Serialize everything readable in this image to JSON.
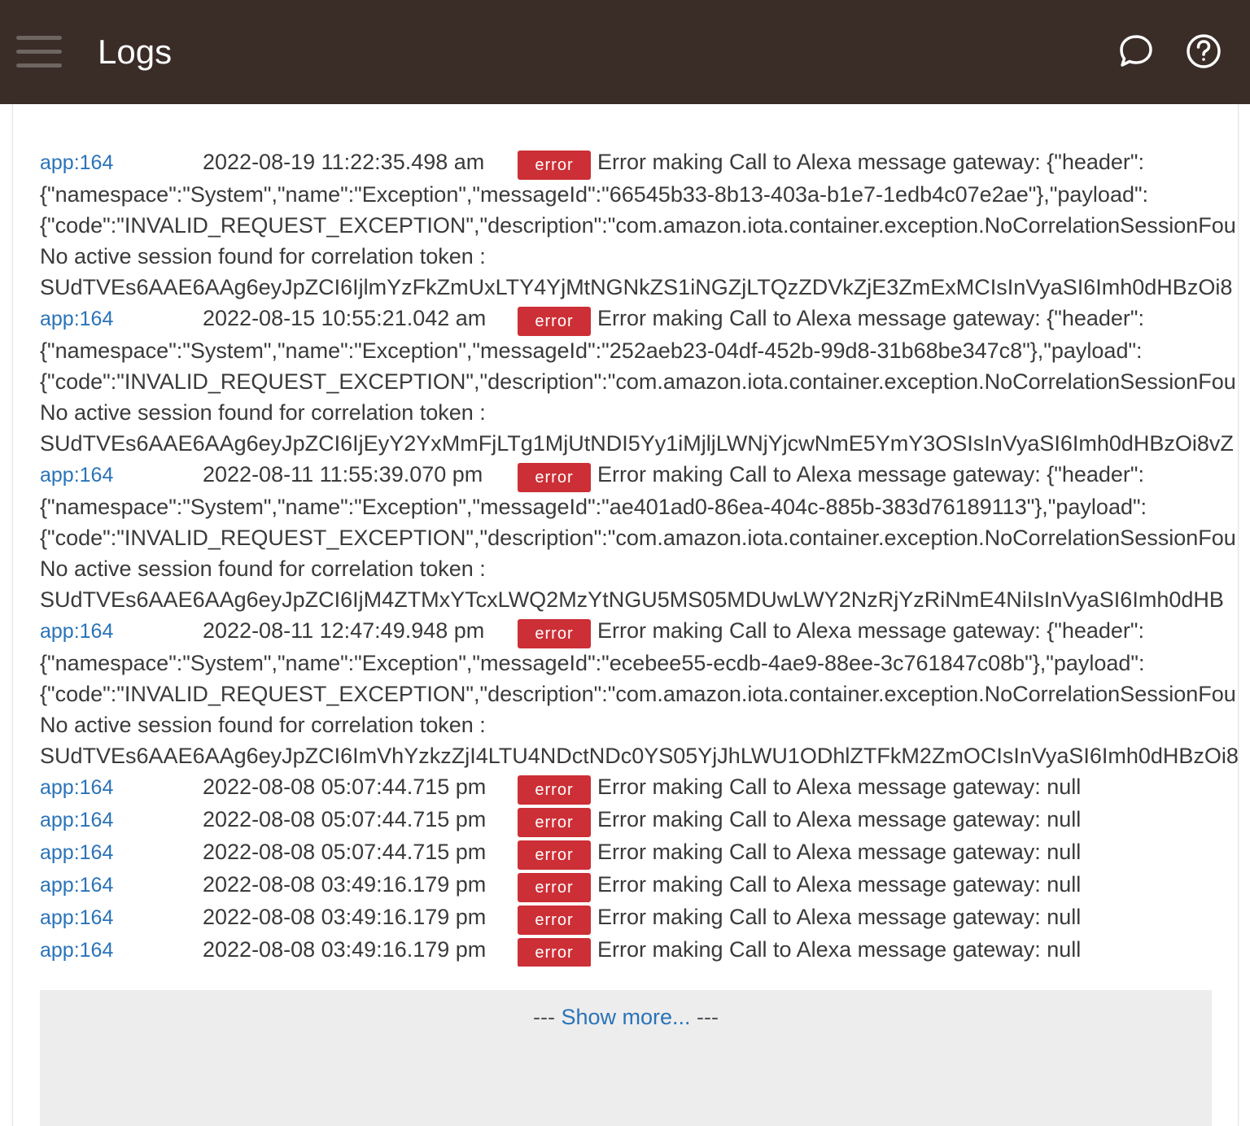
{
  "header": {
    "title": "Logs",
    "menu_icon": "hamburger-menu-icon",
    "chat_icon": "chat-bubble-icon",
    "help_icon": "help-circle-icon",
    "background_color": "#3a2c27"
  },
  "logs": {
    "badge_color": "#cc2f36",
    "link_color": "#2a73b8",
    "entries": [
      {
        "source": "app:164",
        "time": "2022-08-19 11:22:35.498 am",
        "level": "error",
        "message": "Error making Call to Alexa message gateway: {\"header\":",
        "continuation": [
          "{\"namespace\":\"System\",\"name\":\"Exception\",\"messageId\":\"66545b33-8b13-403a-b1e7-1edb4c07e2ae\"},\"payload\":",
          "{\"code\":\"INVALID_REQUEST_EXCEPTION\",\"description\":\"com.amazon.iota.container.exception.NoCorrelationSessionFou",
          "No active session found for correlation token :",
          "SUdTVEs6AAE6AAg6eyJpZCI6IjlmYzFkZmUxLTY4YjMtNGNkZS1iNGZjLTQzZDVkZjE3ZmExMCIsInVyaSI6Imh0dHBzOi8"
        ]
      },
      {
        "source": "app:164",
        "time": "2022-08-15 10:55:21.042 am",
        "level": "error",
        "message": "Error making Call to Alexa message gateway: {\"header\":",
        "continuation": [
          "{\"namespace\":\"System\",\"name\":\"Exception\",\"messageId\":\"252aeb23-04df-452b-99d8-31b68be347c8\"},\"payload\":",
          "{\"code\":\"INVALID_REQUEST_EXCEPTION\",\"description\":\"com.amazon.iota.container.exception.NoCorrelationSessionFou",
          "No active session found for correlation token :",
          "SUdTVEs6AAE6AAg6eyJpZCI6IjEyY2YxMmFjLTg1MjUtNDI5Yy1iMjljLWNjYjcwNmE5YmY3OSIsInVyaSI6Imh0dHBzOi8vZ"
        ]
      },
      {
        "source": "app:164",
        "time": "2022-08-11 11:55:39.070 pm",
        "level": "error",
        "message": "Error making Call to Alexa message gateway: {\"header\":",
        "continuation": [
          "{\"namespace\":\"System\",\"name\":\"Exception\",\"messageId\":\"ae401ad0-86ea-404c-885b-383d76189113\"},\"payload\":",
          "{\"code\":\"INVALID_REQUEST_EXCEPTION\",\"description\":\"com.amazon.iota.container.exception.NoCorrelationSessionFou",
          "No active session found for correlation token :",
          "SUdTVEs6AAE6AAg6eyJpZCI6IjM4ZTMxYTcxLWQ2MzYtNGU5MS05MDUwLWY2NzRjYzRiNmE4NiIsInVyaSI6Imh0dHB"
        ]
      },
      {
        "source": "app:164",
        "time": "2022-08-11 12:47:49.948 pm",
        "level": "error",
        "message": "Error making Call to Alexa message gateway: {\"header\":",
        "continuation": [
          "{\"namespace\":\"System\",\"name\":\"Exception\",\"messageId\":\"ecebee55-ecdb-4ae9-88ee-3c761847c08b\"},\"payload\":",
          "{\"code\":\"INVALID_REQUEST_EXCEPTION\",\"description\":\"com.amazon.iota.container.exception.NoCorrelationSessionFou",
          "No active session found for correlation token :",
          "SUdTVEs6AAE6AAg6eyJpZCI6ImVhYzkzZjI4LTU4NDctNDc0YS05YjJhLWU1ODhlZTFkM2ZmOCIsInVyaSI6Imh0dHBzOi8"
        ]
      },
      {
        "source": "app:164",
        "time": "2022-08-08 05:07:44.715 pm",
        "level": "error",
        "message": "Error making Call to Alexa message gateway: null",
        "continuation": []
      },
      {
        "source": "app:164",
        "time": "2022-08-08 05:07:44.715 pm",
        "level": "error",
        "message": "Error making Call to Alexa message gateway: null",
        "continuation": []
      },
      {
        "source": "app:164",
        "time": "2022-08-08 05:07:44.715 pm",
        "level": "error",
        "message": "Error making Call to Alexa message gateway: null",
        "continuation": []
      },
      {
        "source": "app:164",
        "time": "2022-08-08 03:49:16.179 pm",
        "level": "error",
        "message": "Error making Call to Alexa message gateway: null",
        "continuation": []
      },
      {
        "source": "app:164",
        "time": "2022-08-08 03:49:16.179 pm",
        "level": "error",
        "message": "Error making Call to Alexa message gateway: null",
        "continuation": []
      },
      {
        "source": "app:164",
        "time": "2022-08-08 03:49:16.179 pm",
        "level": "error",
        "message": "Error making Call to Alexa message gateway: null",
        "continuation": []
      }
    ]
  },
  "show_more": {
    "prefix": "---",
    "label": "Show more...",
    "suffix": "---"
  }
}
